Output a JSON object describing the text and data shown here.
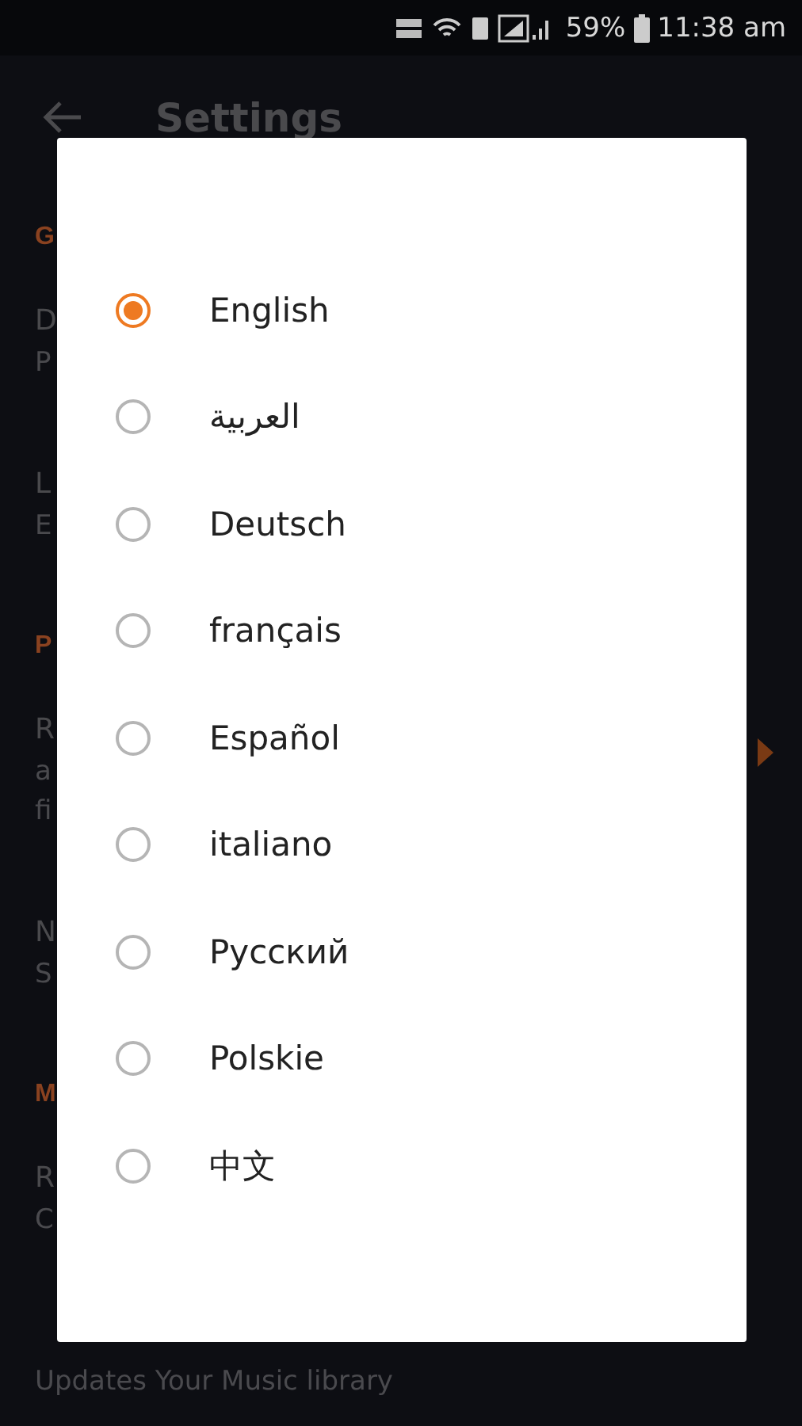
{
  "status_bar": {
    "battery": "59%",
    "time": "11:38 am"
  },
  "app_bar": {
    "title": "Settings"
  },
  "sections": [
    {
      "header": "G",
      "items": [
        {
          "title": "D",
          "subtitle": [
            "P"
          ]
        },
        {
          "title": "L",
          "subtitle": [
            "E"
          ]
        }
      ]
    },
    {
      "header": "P",
      "items": [
        {
          "title": "R",
          "subtitle": [
            "a",
            "fi"
          ],
          "chevron": true
        },
        {
          "title": "N",
          "subtitle": [
            "S"
          ]
        }
      ]
    },
    {
      "header": "M",
      "items": [
        {
          "title": "R",
          "subtitle": [
            "C"
          ]
        },
        {
          "subtitle": [
            "Updates Your Music library"
          ]
        }
      ]
    }
  ],
  "dialog": {
    "options": [
      {
        "label": "English",
        "selected": true
      },
      {
        "label": "العربية",
        "selected": false
      },
      {
        "label": "Deutsch",
        "selected": false
      },
      {
        "label": "français",
        "selected": false
      },
      {
        "label": "Español",
        "selected": false
      },
      {
        "label": "italiano",
        "selected": false
      },
      {
        "label": "Русский",
        "selected": false
      },
      {
        "label": "Polskie",
        "selected": false
      },
      {
        "label": "中文",
        "selected": false
      }
    ]
  }
}
